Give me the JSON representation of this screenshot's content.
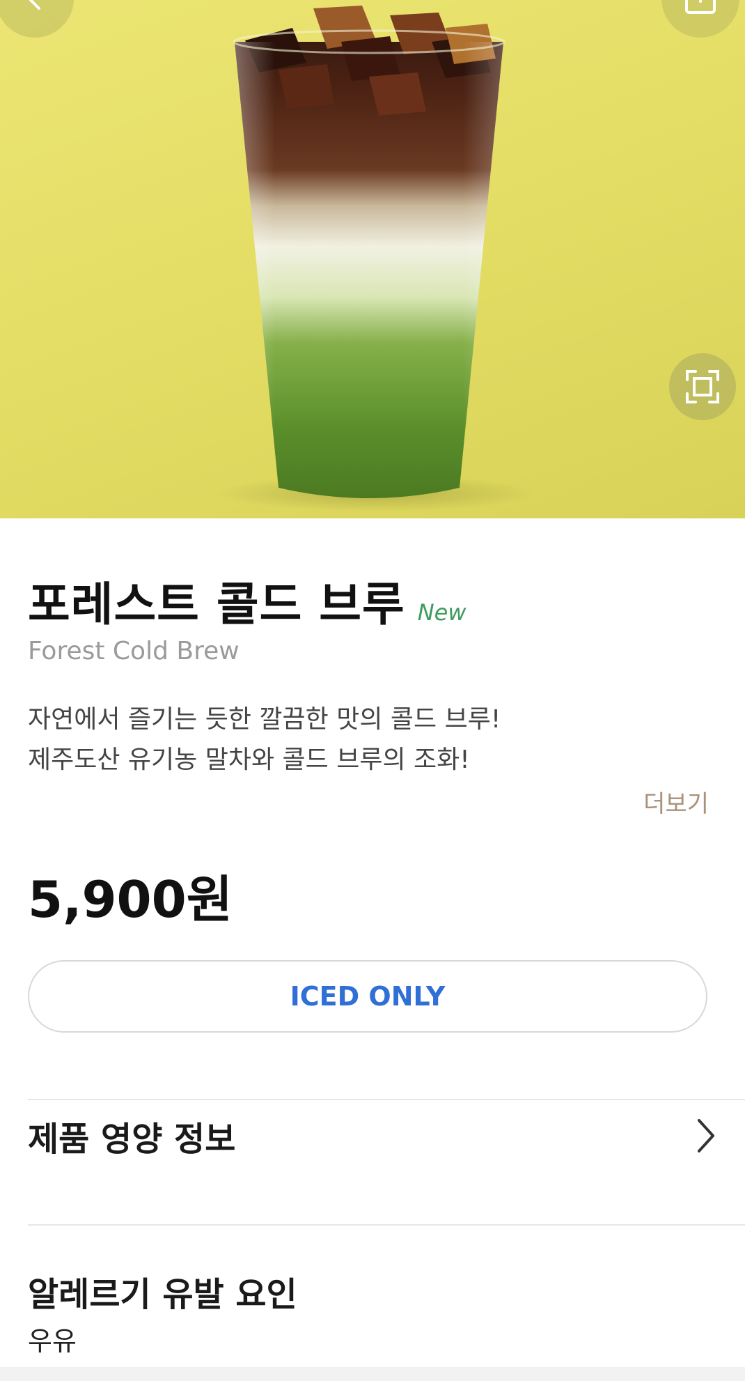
{
  "product": {
    "name_ko": "포레스트 콜드 브루",
    "badge": "New",
    "name_en": "Forest Cold Brew",
    "description_line1": "자연에서 즐기는 듯한 깔끔한 맛의 콜드 브루!",
    "description_line2": "제주도산 유기농 말차와 콜드 브루의 조화!",
    "more_label": "더보기",
    "price": "5,900원",
    "temperature_option": "ICED ONLY"
  },
  "sections": {
    "nutrition_title": "제품 영양 정보",
    "allergy_title": "알레르기 유발 요인",
    "allergy_value": "우유"
  },
  "icons": {
    "back": "chevron-left-icon",
    "share": "share-icon",
    "expand": "expand-icon",
    "nutrition_arrow": "chevron-right-icon"
  },
  "colors": {
    "hero_background": "#e6e06a",
    "badge_green": "#3d9c5e",
    "option_blue": "#2f6fd6",
    "more_brown": "#a8927a"
  }
}
